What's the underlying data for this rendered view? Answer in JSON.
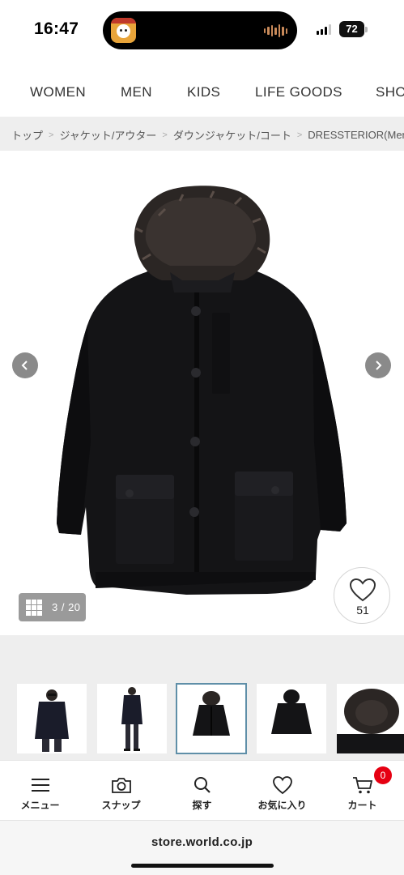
{
  "status_bar": {
    "time": "16:47",
    "battery": "72",
    "island_app_icon": "app-avatar-icon",
    "island_audio_icon": "audio-waveform-icon"
  },
  "category_nav": {
    "items": [
      "WOMEN",
      "MEN",
      "KIDS",
      "LIFE GOODS",
      "SHO"
    ]
  },
  "breadcrumb": {
    "items": [
      "トップ",
      "ジャケット/アウター",
      "ダウンジャケット/コート",
      "DRESSTERIOR(Men)"
    ],
    "separator": ">"
  },
  "gallery": {
    "counter": "3 / 20",
    "favorite_count": "51",
    "prev_icon": "chevron-left-icon",
    "next_icon": "chevron-right-icon",
    "grid_icon": "grid-icon",
    "heart_icon": "heart-icon"
  },
  "thumbnails": {
    "count": 5,
    "selected_index": 2
  },
  "tabbar": {
    "items": [
      {
        "label": "メニュー",
        "icon": "hamburger-menu-icon"
      },
      {
        "label": "スナップ",
        "icon": "camera-icon"
      },
      {
        "label": "探す",
        "icon": "search-icon"
      },
      {
        "label": "お気に入り",
        "icon": "heart-icon"
      },
      {
        "label": "カート",
        "icon": "cart-icon"
      }
    ],
    "cart_badge": "0"
  },
  "browser": {
    "url": "store.world.co.jp"
  },
  "colors": {
    "accent_badge": "#e60012",
    "thumb_selected_border": "#5f8fa8",
    "band_gray": "#eeeeee",
    "jacket": "#141416"
  }
}
